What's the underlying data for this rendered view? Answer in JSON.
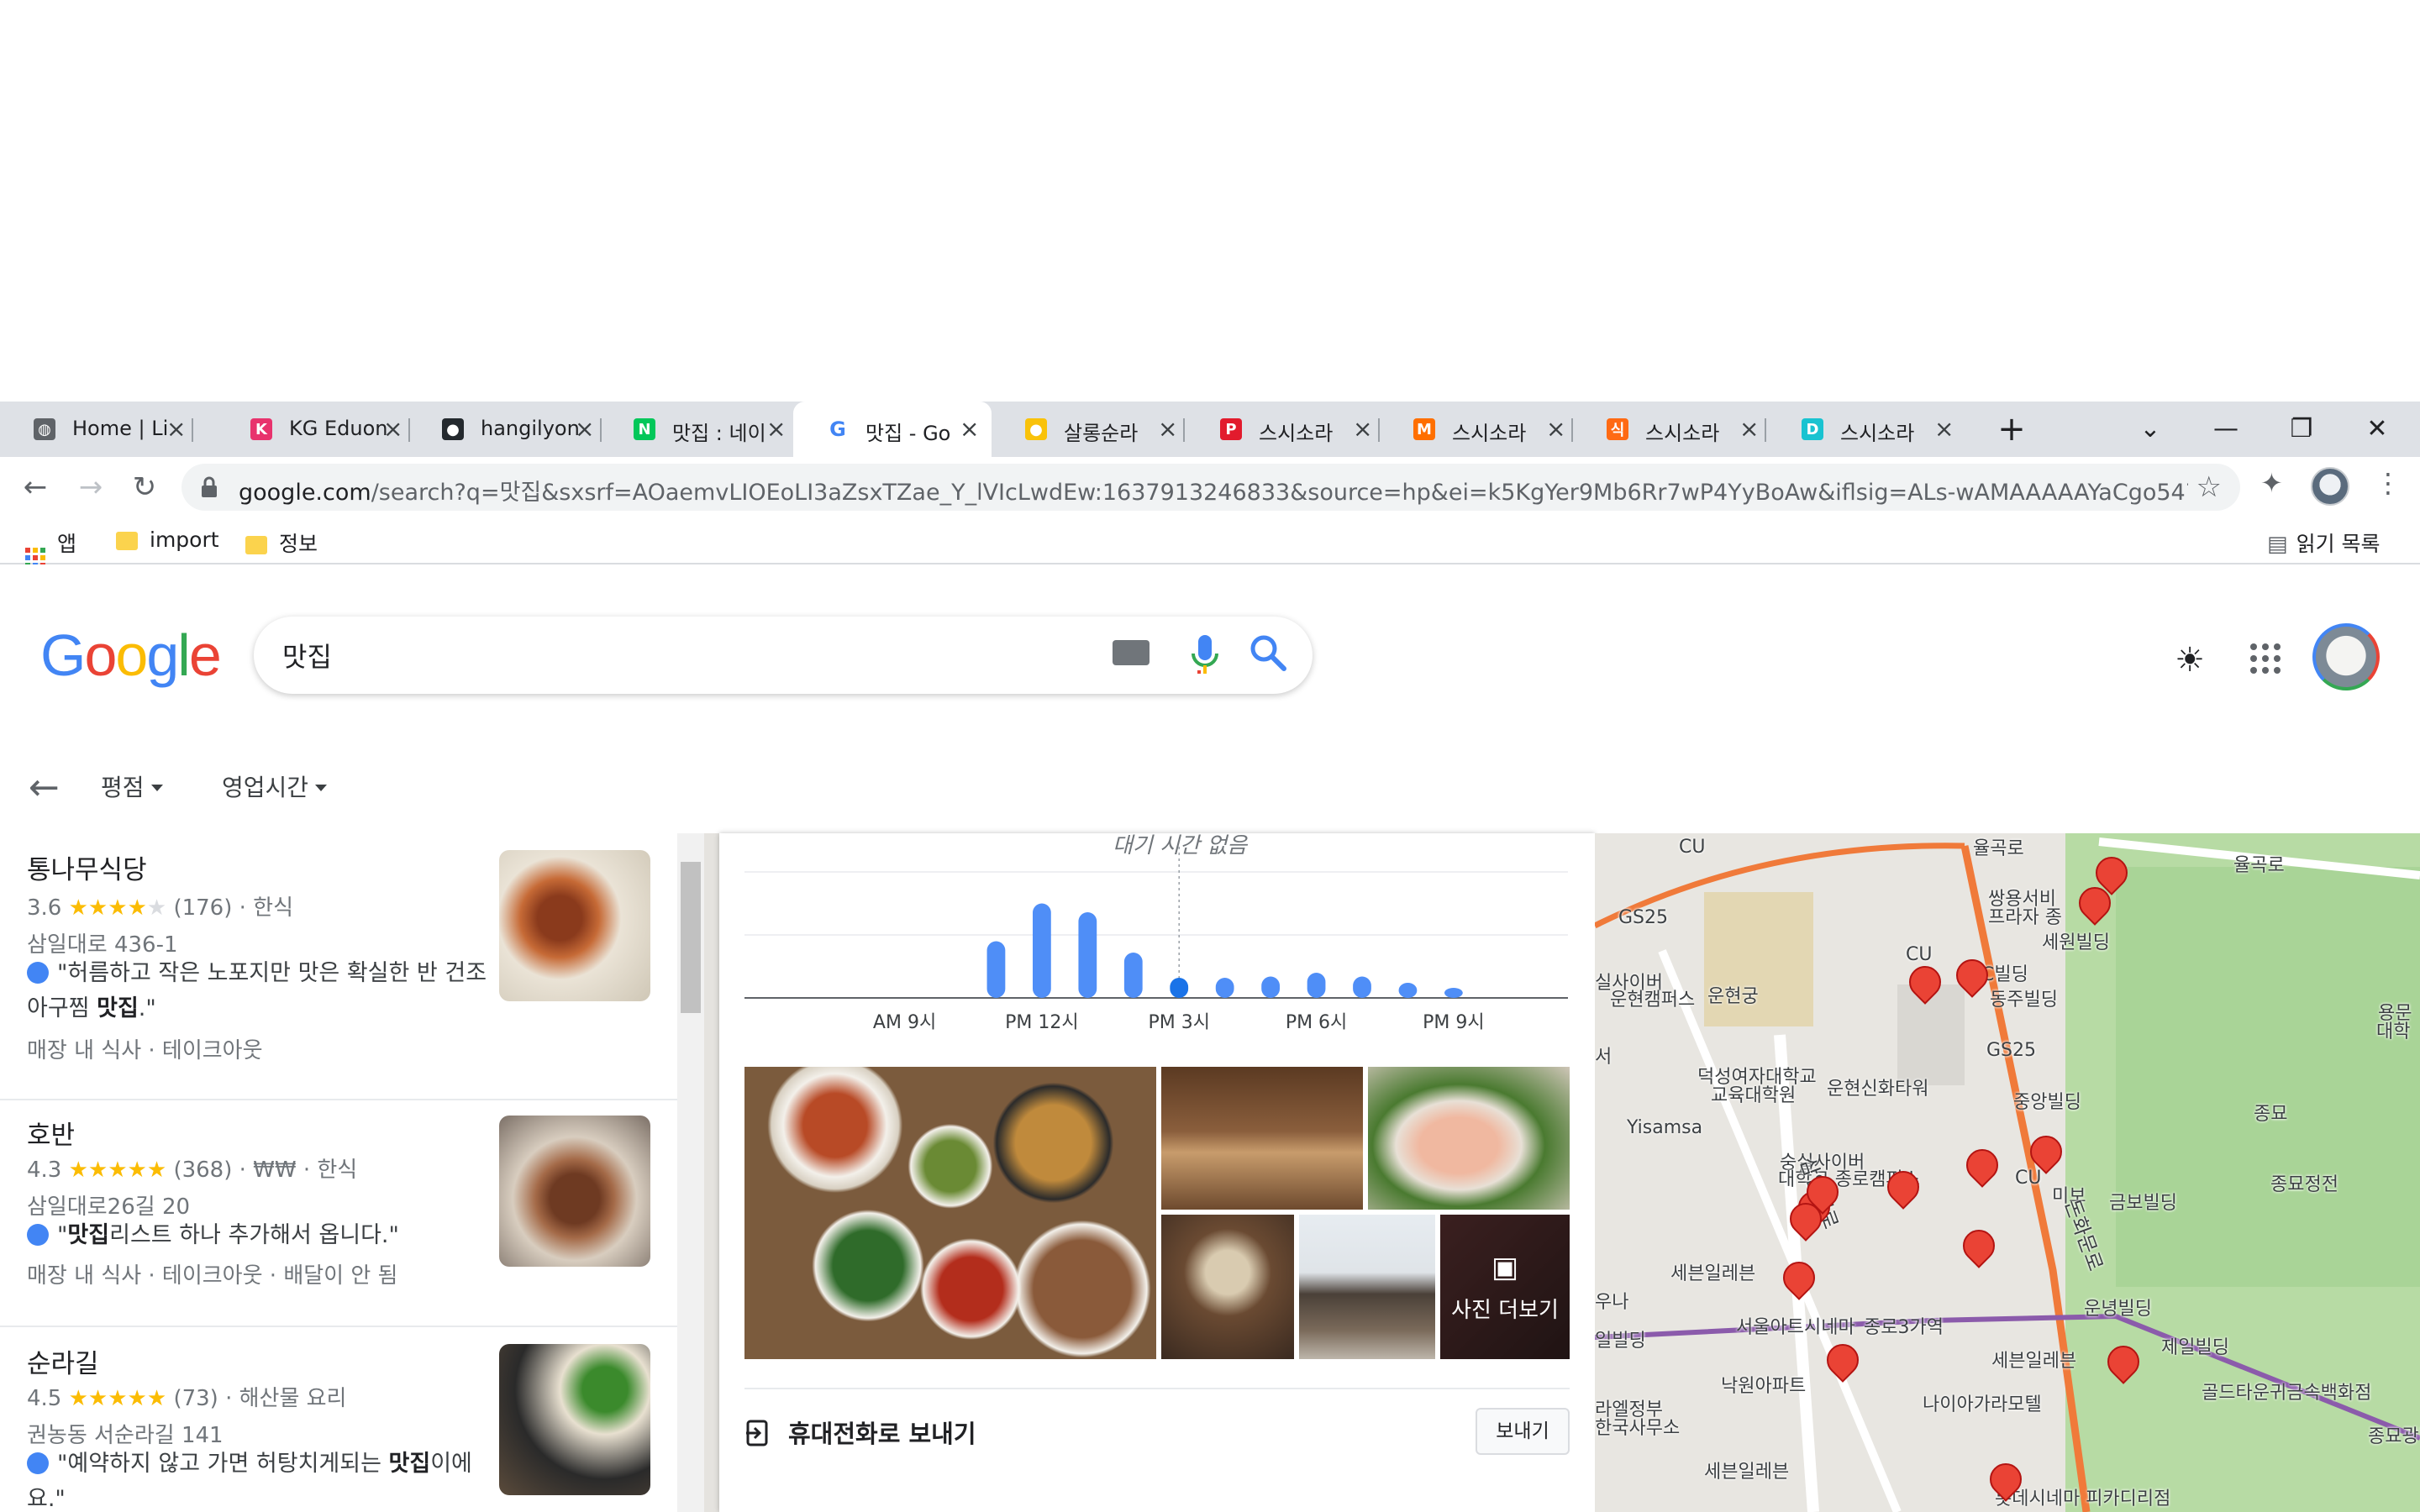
{
  "tabs": [
    {
      "title": "Home | Li",
      "fav_color": "#5f6368",
      "fav_char": "◍"
    },
    {
      "title": "KG Eduon",
      "fav_color": "#e8336d",
      "fav_char": "K"
    },
    {
      "title": "hangilyon",
      "fav_color": "#24292e",
      "fav_char": "●"
    },
    {
      "title": "맛집 : 네이",
      "fav_color": "#03c75a",
      "fav_char": "N"
    },
    {
      "title": "맛집 - Go",
      "fav_color": "#ffffff",
      "fav_char": "G"
    },
    {
      "title": "살롱순라",
      "fav_color": "#f9c20a",
      "fav_char": "●"
    },
    {
      "title": "스시소라",
      "fav_color": "#e21b2d",
      "fav_char": "P"
    },
    {
      "title": "스시소라",
      "fav_color": "#ff6f00",
      "fav_char": "M"
    },
    {
      "title": "스시소라",
      "fav_color": "#ff6a13",
      "fav_char": "식"
    },
    {
      "title": "스시소라",
      "fav_color": "#19c3d1",
      "fav_char": "D"
    }
  ],
  "active_tab": 4,
  "new_tab_label": "+",
  "window": {
    "min": "—",
    "restore": "❐",
    "close": "✕",
    "tab_search": "⌄"
  },
  "address": {
    "url_host": "google.com",
    "url_rest": "/search?q=맛집&sxsrf=AOaemvLIOEoLI3aZsxTZae_Y_lVIcLwdEw:1637913246833&source=hp&ei=k5KgYer9Mb6Rr7wP4YyBoAw&iflsig=ALs-wAMAAAAAYaCgo547U1VXIK..."
  },
  "bookmarks": {
    "apps": "앱",
    "items": [
      "import",
      "정보"
    ],
    "reading_list": "읽기 목록"
  },
  "google": {
    "query": "맛집",
    "filters": [
      "평점",
      "영업시간"
    ]
  },
  "results": [
    {
      "name": "통나무식당",
      "rating": "3.6",
      "stars": 3.5,
      "reviews": "(176)",
      "meta": "· 한식",
      "address": "삼일대로 436-1",
      "quote_pre": "\"허름하고 작은 노포지만 맛은 확실한 반 건조 아구찜 ",
      "quote_bold": "맛집",
      "quote_post": ".\"",
      "services": "매장 내 식사 · 테이크아웃"
    },
    {
      "name": "호반",
      "rating": "4.3",
      "stars": 4.5,
      "reviews": "(368)",
      "meta": "· ₩₩ · 한식",
      "address": "삼일대로26길 20",
      "quote_pre": "\"",
      "quote_bold": "맛집",
      "quote_post": "리스트 하나 추가해서 옵니다.\"",
      "services": "매장 내 식사 · 테이크아웃 · 배달이 안 됨"
    },
    {
      "name": "순라길",
      "rating": "4.5",
      "stars": 4.5,
      "reviews": "(73)",
      "meta": "· 해산물 요리",
      "address": "권농동 서순라길 141",
      "quote_pre": "\"예약하지 않고 가면 허탕치게되는 ",
      "quote_bold": "맛집",
      "quote_post": "이에요.\"",
      "services": ""
    }
  ],
  "detail": {
    "wait_text": "대기 시간 없음",
    "photos_more": "사진 더보기",
    "send_label": "휴대전화로 보내기",
    "send_button": "보내기"
  },
  "chart_data": {
    "type": "bar",
    "title": "",
    "xlabel": "",
    "ylabel": "",
    "x": [
      6,
      7,
      8,
      9,
      10,
      11,
      12,
      13,
      14,
      15,
      16,
      17,
      18,
      19,
      20,
      21,
      22,
      23
    ],
    "tick_labels": [
      "AM 9시",
      "PM 12시",
      "PM 3시",
      "PM 6시",
      "PM 9시"
    ],
    "tick_x": [
      9,
      12,
      15,
      18,
      21
    ],
    "values": [
      0,
      0,
      0,
      0,
      0,
      45,
      75,
      68,
      36,
      16,
      16,
      17,
      20,
      17,
      12,
      8,
      0,
      0
    ],
    "highlight_x": 15,
    "ylim": [
      0,
      100
    ],
    "bar_color": "#4f8ef7",
    "highlight_color": "#1a73e8"
  },
  "map": {
    "labels": [
      "CU",
      "율곡로",
      "율곡로",
      "GS25",
      "쌍용서비",
      "프라자 종",
      "세원빌딩",
      "C빌딩",
      "동주빌딩",
      "CU",
      "실사이버",
      "운현캠퍼스",
      "운현궁",
      "GS25",
      "용문",
      "대학",
      "덕성여자대학교",
      "교육대학원",
      "운현신화타워",
      "중앙빌딩",
      "종묘",
      "Yisamsa",
      "숭실사이버",
      "대학교 종로캠퍼스",
      "CU",
      "미보",
      "금보빌딩",
      "종묘정전",
      "세븐일레븐",
      "운녕빌딩",
      "우나",
      "서울아트시네마",
      "종로3가역",
      "세븐일레븐",
      "제일빌딩",
      "골드타운귀금속백화점",
      "낙원아파트",
      "나이아가라모텔",
      "세븐일레븐",
      "롯데시네마 피카디리점",
      "종묘광장",
      "라엘정부",
      "한국사무소",
      "삼일대로",
      "돈화문로",
      "일빌딩",
      "서"
    ]
  }
}
